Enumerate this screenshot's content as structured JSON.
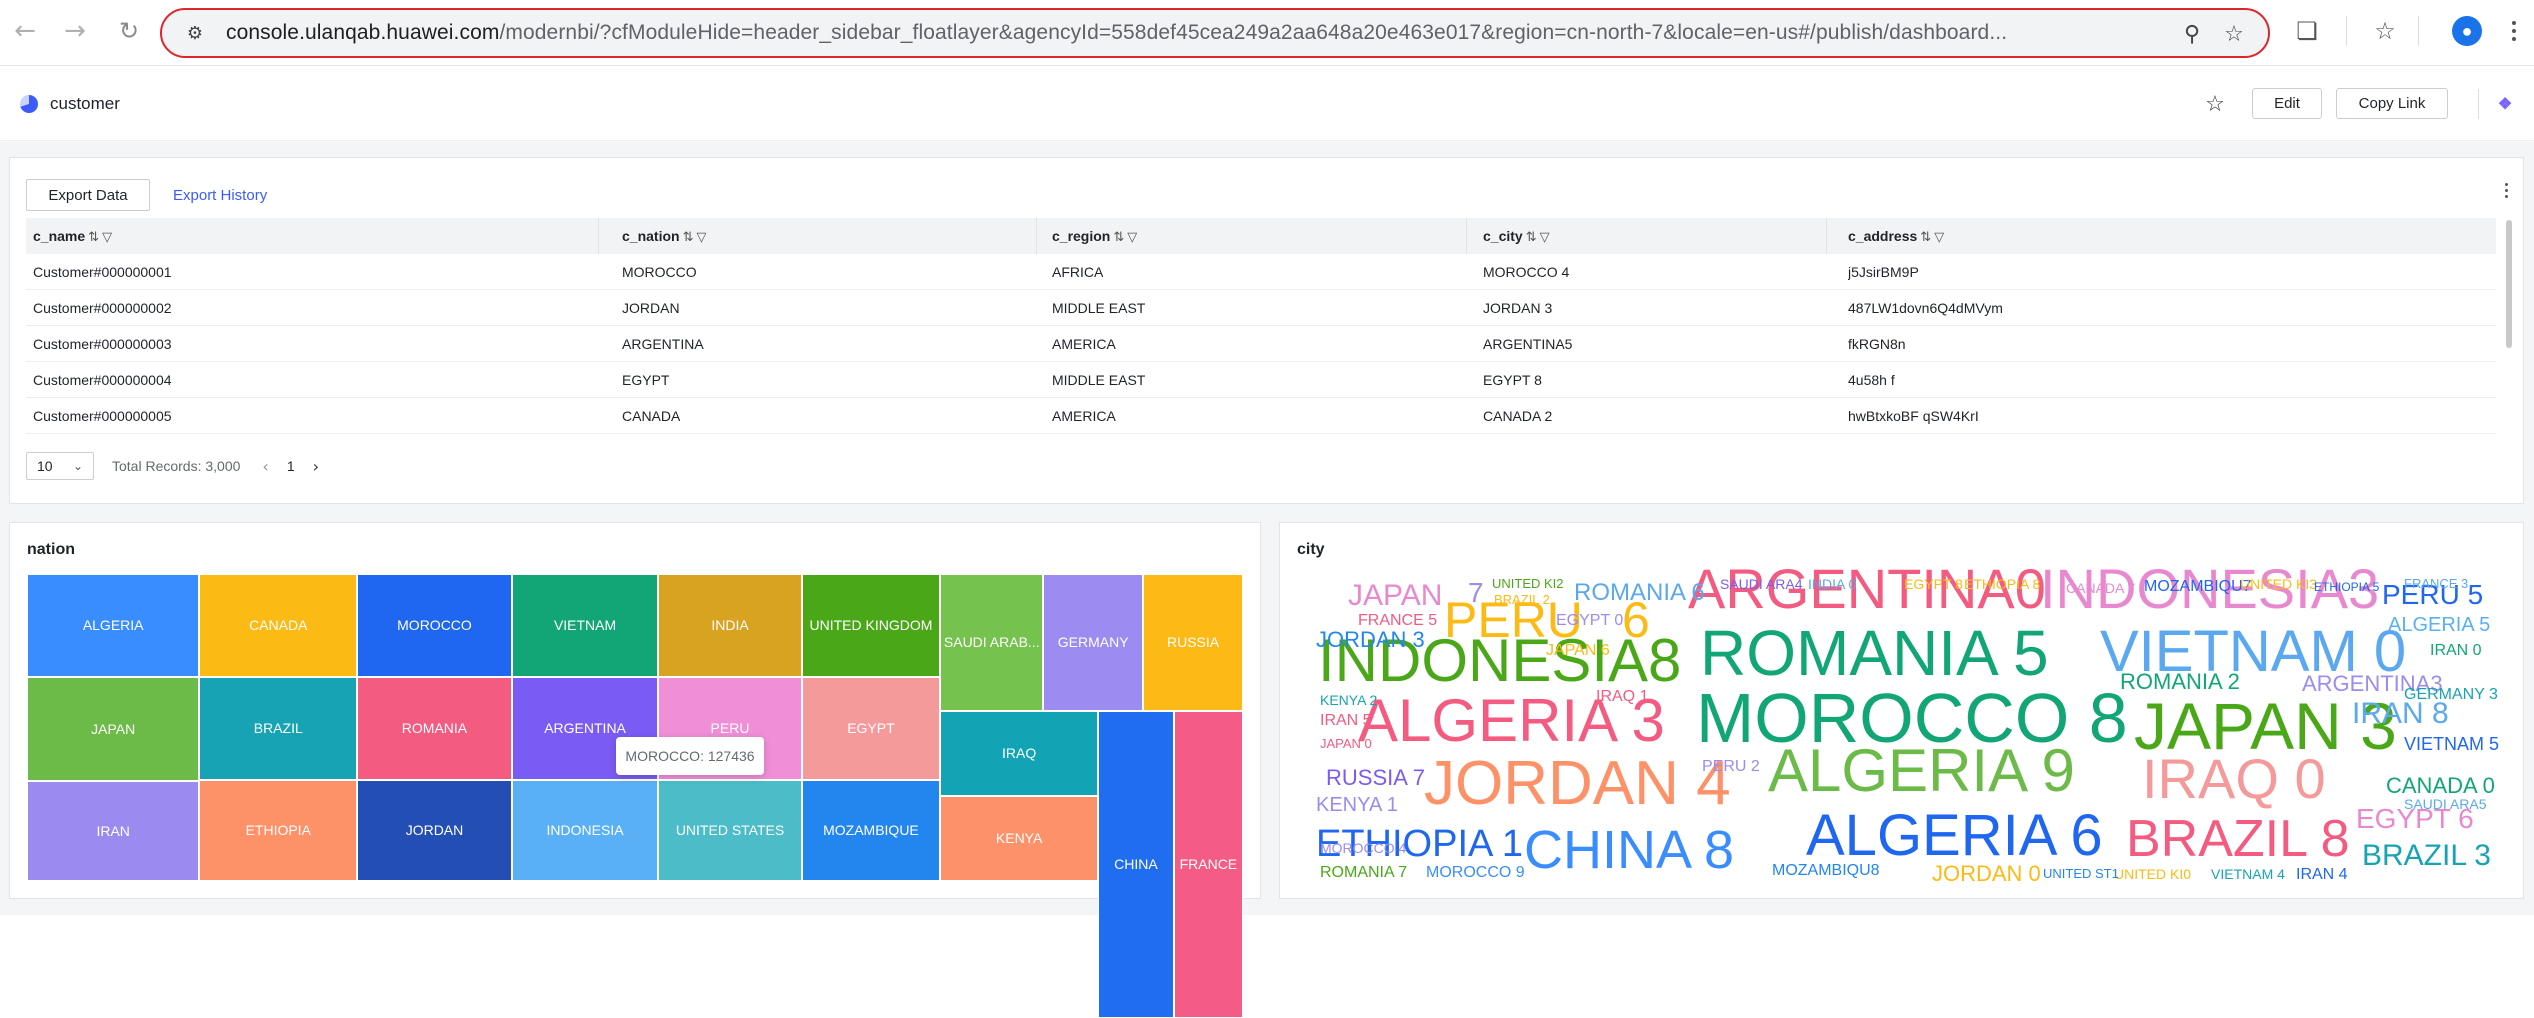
{
  "browser": {
    "url_host": "console.ulanqab.huawei.com",
    "url_rest": "/modernbi/?cfModuleHide=header_sidebar_floatlayer&agencyId=558def45cea249a2aa648a20e463e017&region=cn-north-7&locale=en-us#/publish/dashboard...",
    "icons": [
      "back-arrow-icon",
      "forward-arrow-icon",
      "reload-icon",
      "site-settings-icon",
      "zoom-icon",
      "bookmark-star-icon",
      "extensions-icon",
      "bookmarks-icon",
      "profile-icon",
      "menu-icon"
    ]
  },
  "header": {
    "title": "customer",
    "edit_label": "Edit",
    "copy_link_label": "Copy Link"
  },
  "table_card": {
    "export_data_label": "Export Data",
    "export_history_label": "Export History",
    "columns": [
      "c_name",
      "c_nation",
      "c_region",
      "c_city",
      "c_address"
    ],
    "rows": [
      [
        "Customer#000000001",
        "MOROCCO",
        "AFRICA",
        "MOROCCO 4",
        "j5JsirBM9P"
      ],
      [
        "Customer#000000002",
        "JORDAN",
        "MIDDLE EAST",
        "JORDAN 3",
        "487LW1dovn6Q4dMVym"
      ],
      [
        "Customer#000000003",
        "ARGENTINA",
        "AMERICA",
        "ARGENTINA5",
        "fkRGN8n"
      ],
      [
        "Customer#000000004",
        "EGYPT",
        "MIDDLE EAST",
        "EGYPT 8",
        "4u58h f"
      ],
      [
        "Customer#000000005",
        "CANADA",
        "AMERICA",
        "CANADA 2",
        "hwBtxkoBF qSW4KrI"
      ]
    ],
    "page_size": "10",
    "total_records": "Total Records: 3,000",
    "current_page": "1"
  },
  "nation_chart": {
    "title": "nation",
    "tooltip": "MOROCCO: 127436",
    "chart_data": {
      "type": "treemap",
      "values_known": [
        {
          "label": "MOROCCO",
          "value": 127436
        }
      ],
      "categories": [
        "ALGERIA",
        "CANADA",
        "MOROCCO",
        "VIETNAM",
        "INDIA",
        "UNITED KINGDOM",
        "SAUDI ARAB...",
        "GERMANY",
        "RUSSIA",
        "JAPAN",
        "BRAZIL",
        "ROMANIA",
        "ARGENTINA",
        "PERU",
        "EGYPT",
        "IRAQ",
        "CHINA",
        "FRANCE",
        "IRAN",
        "ETHIOPIA",
        "JORDAN",
        "INDONESIA",
        "UNITED STATES",
        "MOZAMBIQUE",
        "KENYA"
      ]
    },
    "tiles": [
      {
        "label": "ALGERIA",
        "color": "#3a8dff"
      },
      {
        "label": "CANADA",
        "color": "#fcba15"
      },
      {
        "label": "MOROCCO",
        "color": "#1f67f0"
      },
      {
        "label": "VIETNAM",
        "color": "#12a575"
      },
      {
        "label": "INDIA",
        "color": "#d7a320"
      },
      {
        "label": "UNITED KINGDOM",
        "color": "#4aa818"
      },
      {
        "label": "SAUDI ARAB...",
        "color": "#76c24e"
      },
      {
        "label": "GERMANY",
        "color": "#9c8bf0"
      },
      {
        "label": "RUSSIA",
        "color": "#fdba16"
      },
      {
        "label": "JAPAN",
        "color": "#6cba47"
      },
      {
        "label": "BRAZIL",
        "color": "#17a3b4"
      },
      {
        "label": "ROMANIA",
        "color": "#f35b80"
      },
      {
        "label": "ARGENTINA",
        "color": "#7a5cf5"
      },
      {
        "label": "PERU",
        "color": "#f08fd8"
      },
      {
        "label": "EGYPT",
        "color": "#f49a9a"
      },
      {
        "label": "IRAQ",
        "color": "#12a4b4"
      },
      {
        "label": "CHINA",
        "color": "#1f6df0"
      },
      {
        "label": "FRANCE",
        "color": "#f45c85"
      },
      {
        "label": "IRAN",
        "color": "#9b8bf0"
      },
      {
        "label": "ETHIOPIA",
        "color": "#fd9168"
      },
      {
        "label": "JORDAN",
        "color": "#234fb5"
      },
      {
        "label": "INDONESIA",
        "color": "#5ab0f4"
      },
      {
        "label": "UNITED STATES",
        "color": "#4cbcc8"
      },
      {
        "label": "MOZAMBIQUE",
        "color": "#2386ef"
      },
      {
        "label": "KENYA",
        "color": "#fd926a"
      }
    ]
  },
  "city_chart": {
    "title": "city",
    "words": [
      {
        "text": "ARGENTINA0",
        "color": "#f35b80"
      },
      {
        "text": "INDONESIA3",
        "color": "#e889d0"
      },
      {
        "text": "ROMANIA 5",
        "color": "#12a575"
      },
      {
        "text": "VIETNAM 0",
        "color": "#5aa8f0"
      },
      {
        "text": "INDONESIA8",
        "color": "#4aa818"
      },
      {
        "text": "MOROCCO 8",
        "color": "#12a575"
      },
      {
        "text": "ALGERIA 3",
        "color": "#f35b80"
      },
      {
        "text": "JAPAN 3",
        "color": "#4aa818"
      },
      {
        "text": "ALGERIA 9",
        "color": "#6cba47"
      },
      {
        "text": "JORDAN 4",
        "color": "#fd9168"
      },
      {
        "text": "IRAQ 0",
        "color": "#f49a9a"
      },
      {
        "text": "ALGERIA 6",
        "color": "#1f67f0"
      },
      {
        "text": "BRAZIL 8",
        "color": "#f35b80"
      },
      {
        "text": "CHINA 8",
        "color": "#3a8dff"
      },
      {
        "text": "ETHIOPIA 1",
        "color": "#1f67f0"
      },
      {
        "text": "PERU",
        "color": "#fcba15"
      },
      {
        "text": "6",
        "color": "#fcba15"
      },
      {
        "text": "JAPAN",
        "color": "#e889d0"
      },
      {
        "text": "7",
        "color": "#9c8bf0"
      },
      {
        "text": "ROMANIA 6",
        "color": "#5aa8f0"
      },
      {
        "text": "JORDAN 3",
        "color": "#2386ef"
      },
      {
        "text": "RUSSIA 7",
        "color": "#7a5cf5"
      },
      {
        "text": "KENYA 1",
        "color": "#9c8bf0"
      },
      {
        "text": "ROMANIA 2",
        "color": "#12a575"
      },
      {
        "text": "ARGENTINA3",
        "color": "#9c8bf0"
      },
      {
        "text": "IRAN 8",
        "color": "#5aa8f0"
      },
      {
        "text": "CANADA 0",
        "color": "#12a575"
      },
      {
        "text": "EGYPT 6",
        "color": "#e889d0"
      },
      {
        "text": "BRAZIL 3",
        "color": "#17a3b4"
      },
      {
        "text": "PERU 5",
        "color": "#1f67f0"
      },
      {
        "text": "ALGERIA 5",
        "color": "#5ab0f4"
      },
      {
        "text": "MOZAMBIQU7",
        "color": "#1f67f0"
      },
      {
        "text": "MOZAMBIQU8",
        "color": "#2386ef"
      },
      {
        "text": "JORDAN 0",
        "color": "#fcba15"
      },
      {
        "text": "ROMANIA 7",
        "color": "#4aa818"
      },
      {
        "text": "MOROCCO 9",
        "color": "#3a8dff"
      },
      {
        "text": "IRAN 4",
        "color": "#1f67f0"
      },
      {
        "text": "VIETNAM 4",
        "color": "#17a3b4"
      },
      {
        "text": "UNITED KI0",
        "color": "#fcba15"
      },
      {
        "text": "GERMANY 3",
        "color": "#17a3b4"
      },
      {
        "text": "FRANCE 5",
        "color": "#f35b80"
      },
      {
        "text": "EGYPT 0",
        "color": "#9c8bf0"
      },
      {
        "text": "JAPAN 6",
        "color": "#fcba15"
      },
      {
        "text": "VIETNAM 5",
        "color": "#1f67f0"
      },
      {
        "text": "IRAN 0",
        "color": "#12a575"
      },
      {
        "text": "SAUDI ARA5",
        "color": "#5aa8f0"
      },
      {
        "text": "IRAN 5",
        "color": "#f35b80"
      },
      {
        "text": "KENYA 2",
        "color": "#17a3b4"
      },
      {
        "text": "PERU 2",
        "color": "#9c8bf0"
      },
      {
        "text": "UNITED KI2",
        "color": "#4aa818"
      },
      {
        "text": "UNITED KI3",
        "color": "#fcba15"
      },
      {
        "text": "SAUDI ARA4",
        "color": "#7a5cf5"
      },
      {
        "text": "INDIA 0",
        "color": "#5aa8f0"
      },
      {
        "text": "EGYPT 8",
        "color": "#fcba15"
      },
      {
        "text": "ETHIOPIA 8",
        "color": "#fcba15"
      },
      {
        "text": "CANADA 7",
        "color": "#e889d0"
      },
      {
        "text": "ETHIOPIA 5",
        "color": "#1f67f0"
      },
      {
        "text": "FRANCE 3",
        "color": "#5aa8f0"
      },
      {
        "text": "UNITED ST1",
        "color": "#2386ef"
      },
      {
        "text": "MOROCCO 4",
        "color": "#9c8bf0"
      },
      {
        "text": "BRAZIL 2",
        "color": "#fcba15"
      },
      {
        "text": "IRAQ 1",
        "color": "#f35b80"
      },
      {
        "text": "JAPAN 0",
        "color": "#f35b80"
      }
    ]
  }
}
